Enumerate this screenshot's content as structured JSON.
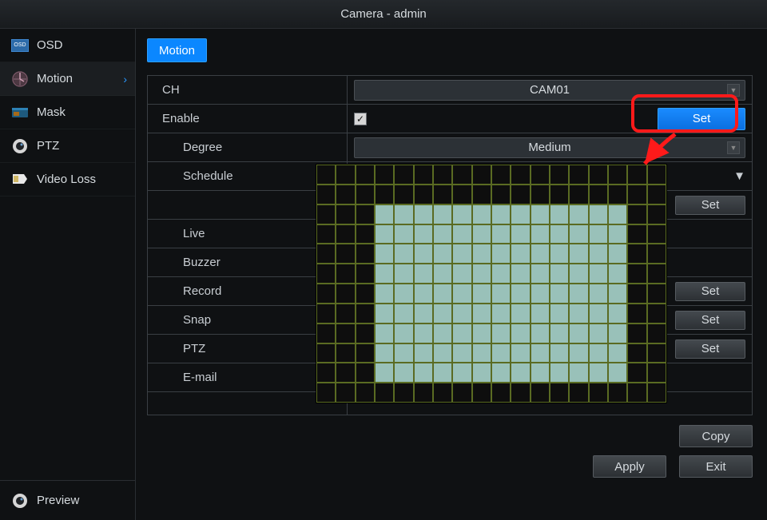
{
  "window": {
    "title": "Camera - admin"
  },
  "sidebar": {
    "items": [
      {
        "label": "OSD"
      },
      {
        "label": "Motion"
      },
      {
        "label": "Mask"
      },
      {
        "label": "PTZ"
      },
      {
        "label": "Video Loss"
      }
    ],
    "footer_label": "Preview"
  },
  "tabs": {
    "active": "Motion"
  },
  "form": {
    "ch": {
      "label": "CH",
      "value": "CAM01"
    },
    "enable": {
      "label": "Enable",
      "checked": true,
      "set_btn": "Set"
    },
    "degree": {
      "label": "Degree",
      "value": "Medium"
    },
    "schedule": {
      "label": "Schedule",
      "set_btn": "Set"
    },
    "live": {
      "label": "Live"
    },
    "buzzer": {
      "label": "Buzzer"
    },
    "record": {
      "label": "Record",
      "set_btn": "Set"
    },
    "snap": {
      "label": "Snap",
      "set_btn": "Set"
    },
    "ptz": {
      "label": "PTZ",
      "set_btn": "Set"
    },
    "email": {
      "label": "E-mail"
    }
  },
  "buttons": {
    "copy": "Copy",
    "apply": "Apply",
    "exit": "Exit"
  },
  "grid_popup": {
    "cols": 18,
    "rows": 12,
    "selected_area": {
      "col_start": 3,
      "col_end": 15,
      "row_start": 2,
      "row_end": 10
    }
  }
}
